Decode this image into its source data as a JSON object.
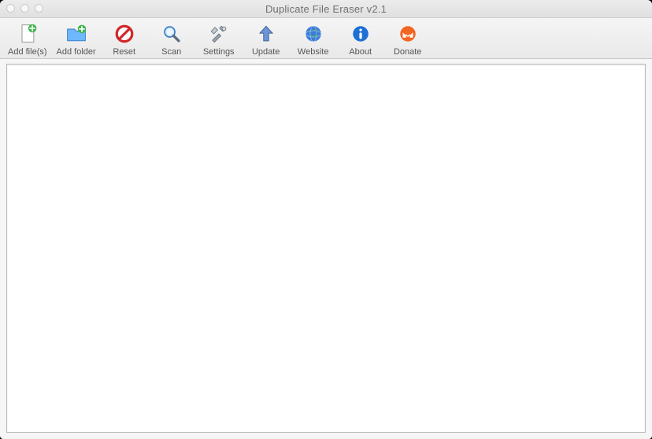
{
  "window": {
    "title": "Duplicate File Eraser v2.1"
  },
  "toolbar": {
    "items": [
      {
        "id": "add-files",
        "label": "Add file(s)",
        "icon": "file-add"
      },
      {
        "id": "add-folder",
        "label": "Add folder",
        "icon": "folder-add"
      },
      {
        "id": "reset",
        "label": "Reset",
        "icon": "no-entry"
      },
      {
        "id": "scan",
        "label": "Scan",
        "icon": "magnifier"
      },
      {
        "id": "settings",
        "label": "Settings",
        "icon": "wrench"
      },
      {
        "id": "update",
        "label": "Update",
        "icon": "arrow-up"
      },
      {
        "id": "website",
        "label": "Website",
        "icon": "globe"
      },
      {
        "id": "about",
        "label": "About",
        "icon": "info"
      },
      {
        "id": "donate",
        "label": "Donate",
        "icon": "coin"
      }
    ]
  }
}
